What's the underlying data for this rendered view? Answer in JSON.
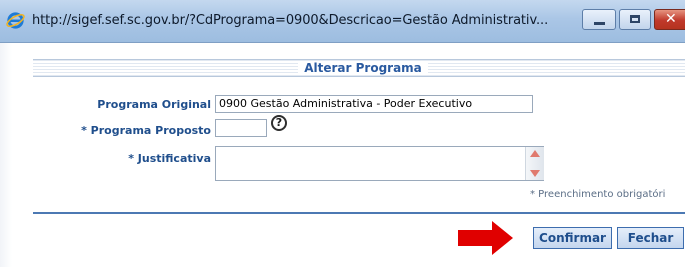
{
  "window": {
    "title": "http://sigef.sef.sc.gov.br/?CdPrograma=0900&Descricao=Gestão Administrativ...",
    "minimize_icon": "minimize-icon",
    "maximize_icon": "maximize-icon",
    "close_icon": "close-icon",
    "close_glyph": "✕"
  },
  "section": {
    "title": "Alterar Programa"
  },
  "form": {
    "programa_original_label": "Programa Original",
    "programa_original_value": "0900 Gestão Administrativa - Poder Executivo",
    "programa_proposto_label": "* Programa Proposto",
    "programa_proposto_value": "",
    "help_glyph": "?",
    "justificativa_label": "* Justificativa",
    "justificativa_value": "",
    "required_note": "* Preenchimento obrigatóri"
  },
  "buttons": {
    "confirmar": "Confirmar",
    "fechar": "Fechar"
  },
  "colors": {
    "accent": "#1f4e8c",
    "arrow": "#e00000",
    "titlebar": "#aac6e6"
  }
}
